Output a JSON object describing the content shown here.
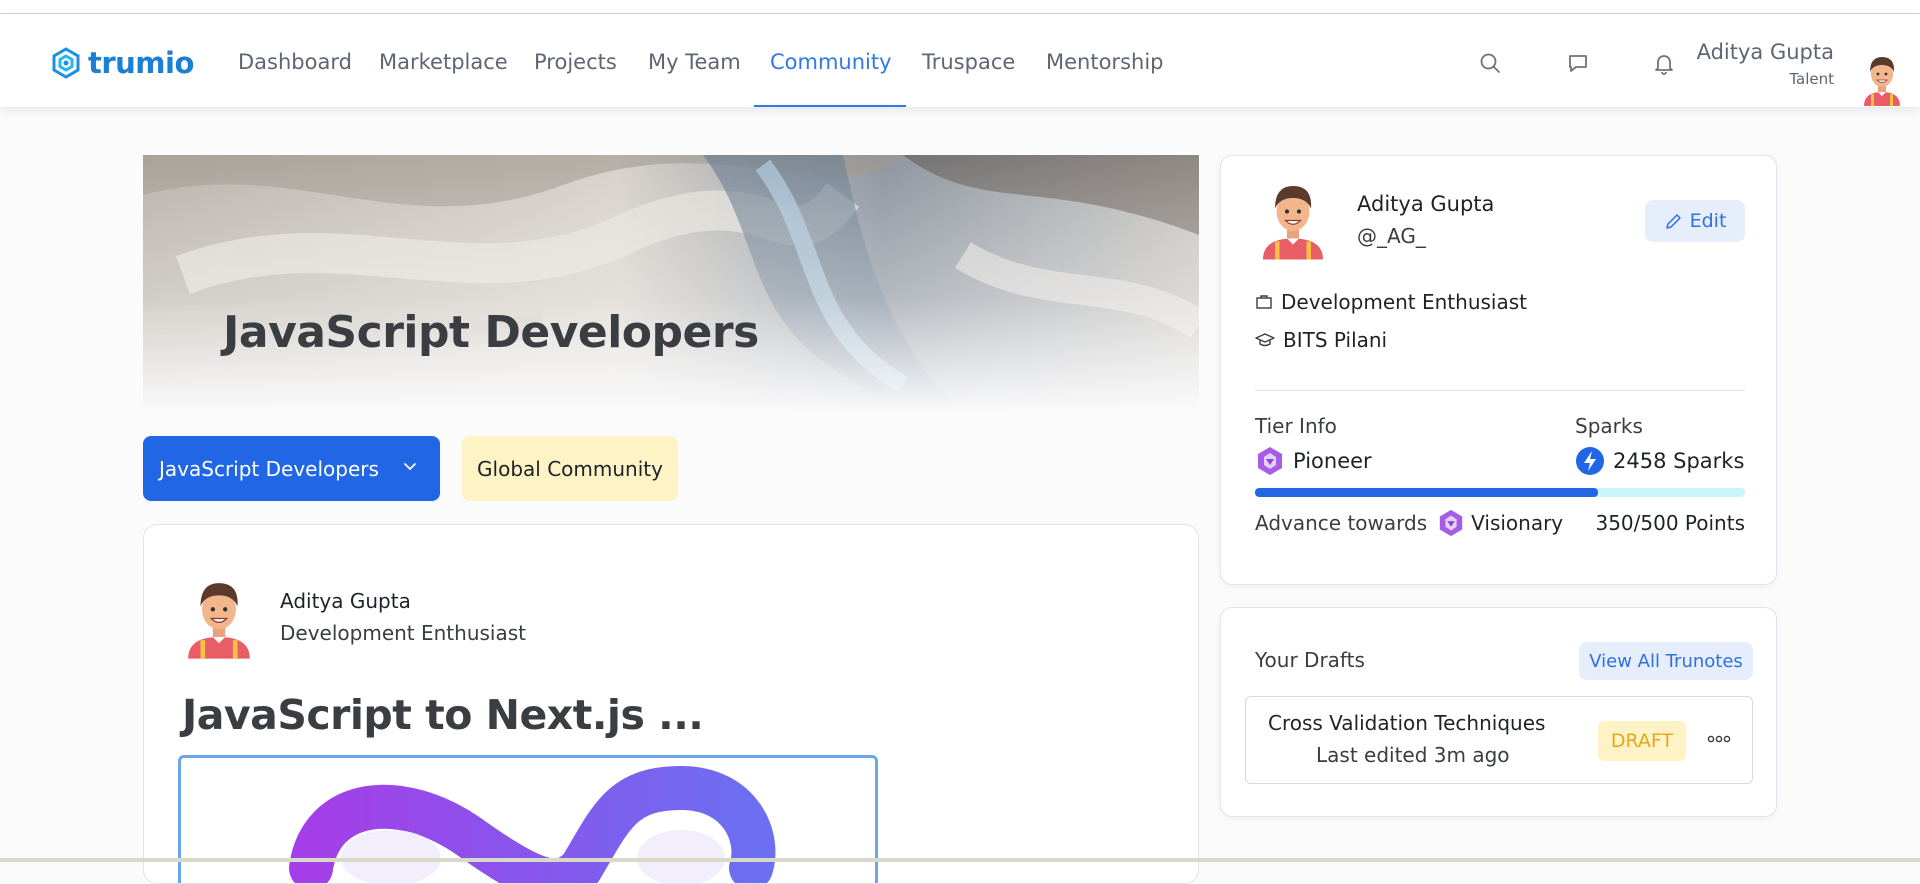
{
  "brand": {
    "name": "trumio",
    "color": "#1b7fd6"
  },
  "nav": {
    "items": [
      {
        "label": "Dashboard"
      },
      {
        "label": "Marketplace"
      },
      {
        "label": "Projects"
      },
      {
        "label": "My Team"
      },
      {
        "label": "Community",
        "active": true
      },
      {
        "label": "Truspace"
      },
      {
        "label": "Mentorship"
      }
    ],
    "icons": [
      "search-icon",
      "chat-icon",
      "bell-icon"
    ]
  },
  "user": {
    "name": "Aditya Gupta",
    "role": "Talent"
  },
  "banner": {
    "title": "JavaScript Developers"
  },
  "filters": {
    "community_select": "JavaScript Developers",
    "global_button": "Global Community"
  },
  "post": {
    "author": "Aditya Gupta",
    "author_role": "Development Enthusiast",
    "title": "JavaScript to Next.js ..."
  },
  "profile": {
    "name": "Aditya Gupta",
    "handle": "@_AG_",
    "edit_label": "Edit",
    "headline": "Development Enthusiast",
    "school": "BITS Pilani",
    "tier_label": "Tier Info",
    "tier_value": "Pioneer",
    "sparks_label": "Sparks",
    "sparks_value": "2458 Sparks",
    "progress_fraction": 0.7,
    "advance_prefix": "Advance towards",
    "advance_target": "Visionary",
    "advance_points": "350/500 Points"
  },
  "drafts": {
    "title": "Your Drafts",
    "view_all": "View All Trunotes",
    "items": [
      {
        "name": "Cross Validation Techniques",
        "edited": "Last edited 3m ago",
        "badge": "DRAFT"
      }
    ]
  },
  "colors": {
    "accent": "#2166e4",
    "draft_badge_bg": "#fdf3c4",
    "draft_badge_text": "#e4a81b"
  }
}
